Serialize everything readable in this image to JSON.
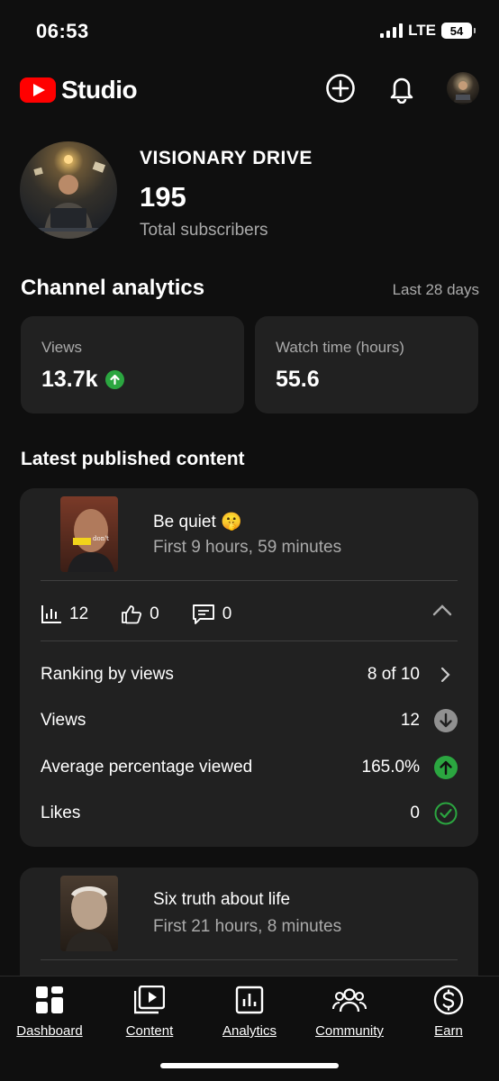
{
  "status_bar": {
    "time": "06:53",
    "network": "LTE",
    "battery": "54"
  },
  "header": {
    "logo_text": "Studio",
    "icons": [
      "create-icon",
      "bell-icon",
      "avatar"
    ]
  },
  "channel": {
    "name": "VISIONARY DRIVE",
    "subscribers": "195",
    "subscribers_label": "Total subscribers"
  },
  "analytics": {
    "title": "Channel analytics",
    "period": "Last 28 days",
    "cards": [
      {
        "label": "Views",
        "value": "13.7k",
        "trend": "up"
      },
      {
        "label": "Watch time (hours)",
        "value": "55.6"
      }
    ]
  },
  "latest": {
    "title": "Latest published content",
    "items": [
      {
        "title": "Be quiet 🤫",
        "subtitle": "First 9 hours, 59 minutes",
        "thumb_text": "don't",
        "views": "12",
        "likes": "0",
        "comments": "0",
        "details": [
          {
            "label": "Ranking by views",
            "value": "8 of 10",
            "indicator": "chevron-right"
          },
          {
            "label": "Views",
            "value": "12",
            "indicator": "down"
          },
          {
            "label": "Average percentage viewed",
            "value": "165.0%",
            "indicator": "up"
          },
          {
            "label": "Likes",
            "value": "0",
            "indicator": "check"
          }
        ]
      },
      {
        "title": "Six truth about life",
        "subtitle": "First 21 hours, 8 minutes"
      }
    ]
  },
  "nav": {
    "items": [
      "Dashboard",
      "Content",
      "Analytics",
      "Community",
      "Earn"
    ]
  },
  "colors": {
    "background": "#0f0f0f",
    "card": "#212121",
    "accent_red": "#ff0000",
    "positive_green": "#2ba640",
    "muted_text": "#aaaaaa"
  }
}
